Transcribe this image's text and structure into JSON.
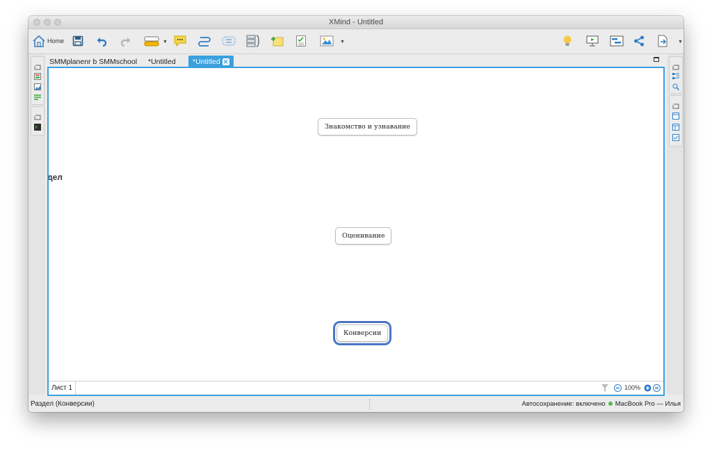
{
  "window": {
    "title": "XMind - Untitled"
  },
  "toolbar": {
    "home_label": "Home",
    "icons": [
      "home-icon",
      "save-icon",
      "undo-icon",
      "redo-icon",
      "topic-icon",
      "callout-icon",
      "relationship-icon",
      "boundary-icon",
      "summary-icon",
      "note-icon",
      "task-icon",
      "image-icon",
      "bulb-icon",
      "presentation-icon",
      "gantt-icon",
      "share-icon",
      "export-icon"
    ]
  },
  "tabs": [
    {
      "label": "SMMplanenr b SMMschool"
    },
    {
      "label": "*Untitled"
    },
    {
      "label": "*Untitled",
      "active": true
    }
  ],
  "canvas": {
    "stray_label": "дел",
    "topics": [
      {
        "label": "Знакомство и узнавание"
      },
      {
        "label": "Оценивание"
      },
      {
        "label": "Конверсии",
        "selected": true
      }
    ]
  },
  "sheet": {
    "tab_label": "Лист 1",
    "zoom": "100%"
  },
  "status": {
    "left": "Раздел (Конверсии)",
    "autosave": "Автосохранение: включено",
    "user": "MacBook Pro — Илья"
  },
  "colors": {
    "accent": "#3aa0de",
    "selection": "#4a74c4",
    "status_dot": "#4cbf4c"
  }
}
